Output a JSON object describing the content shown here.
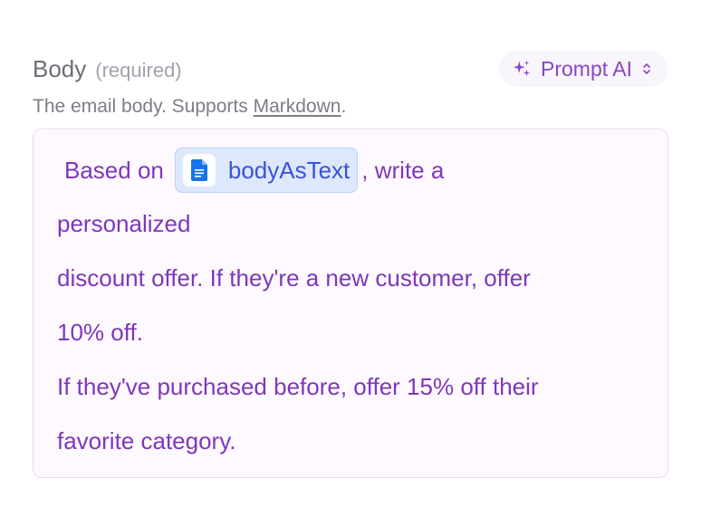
{
  "field": {
    "label": "Body",
    "required": "(required)",
    "help_prefix": "The email body. Supports ",
    "help_link": "Markdown",
    "help_suffix": "."
  },
  "prompt_button": {
    "label": "Prompt AI"
  },
  "editor": {
    "line1_before": "Based on",
    "chip_label": "bodyAsText",
    "line1_after": ", write a",
    "lines": [
      "personalized",
      "discount offer. If they're a new customer, offer",
      "10% off.",
      "If they've purchased before, offer 15% off their",
      "favorite category."
    ]
  },
  "icons": {
    "prompt": "sparkles-icon",
    "chevron": "chevron-up-down-icon",
    "chip": "google-docs-icon"
  },
  "colors": {
    "accent": "#8a45c6",
    "editor_text": "#7f37b8",
    "chip_bg": "#dde8fc",
    "chip_text": "#3a52d8",
    "doc_icon": "#1a73e8"
  }
}
